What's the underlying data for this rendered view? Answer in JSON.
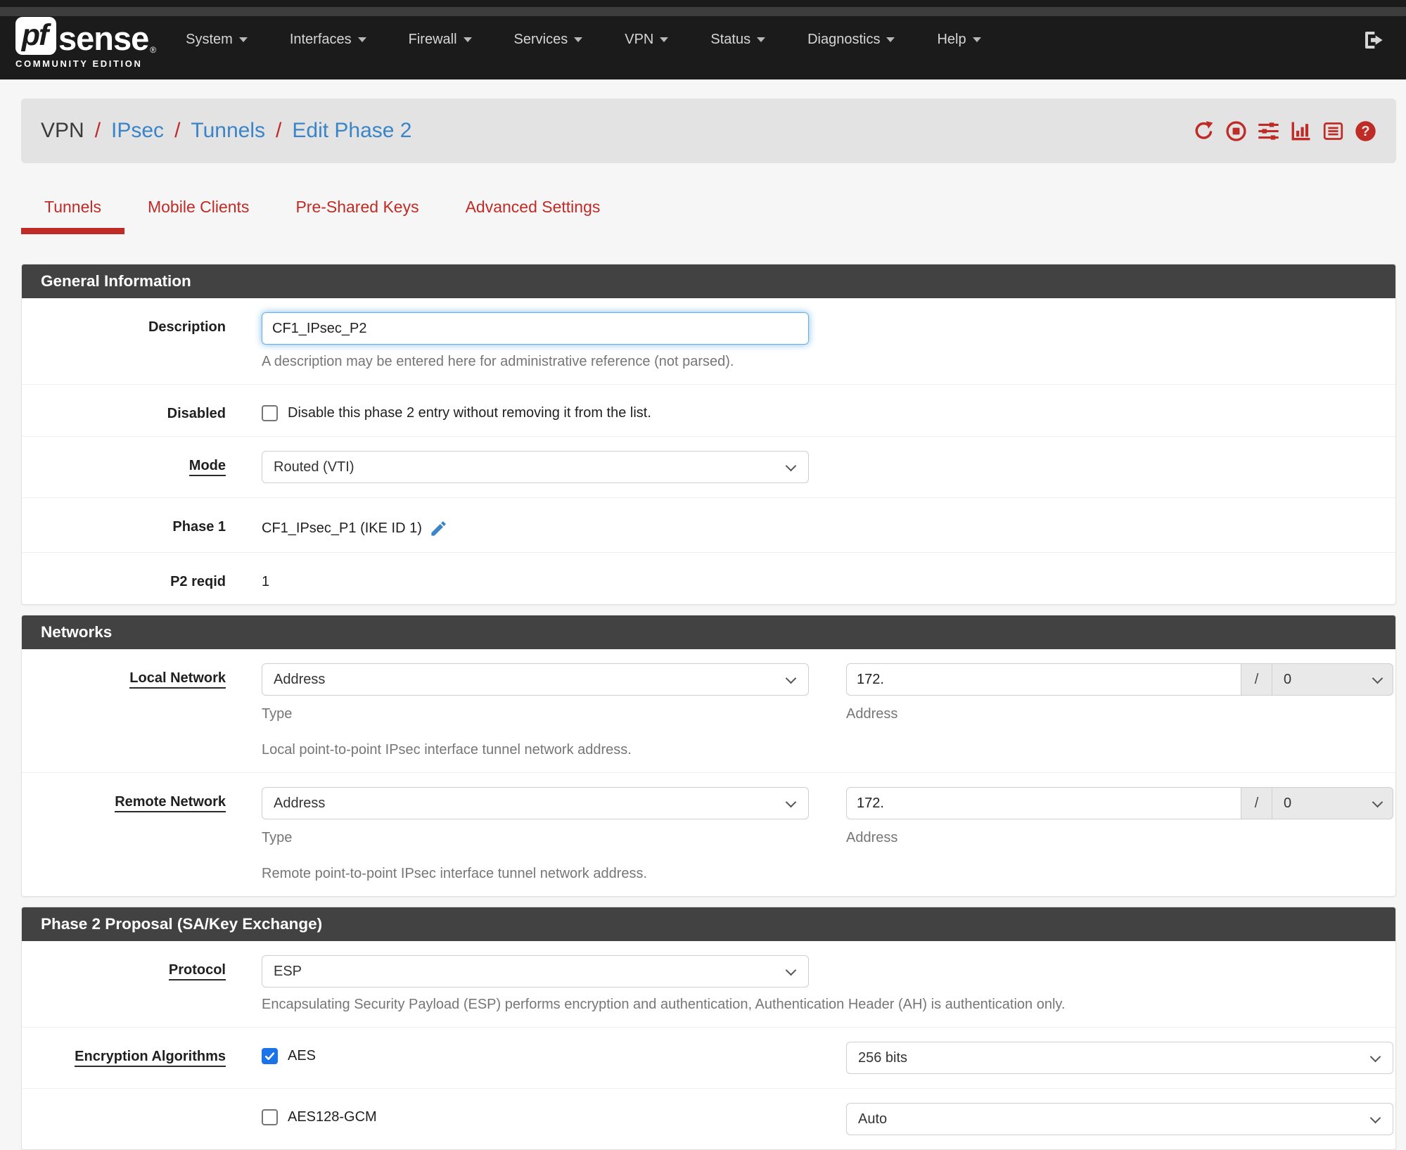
{
  "colors": {
    "navbar_bg": "#1b1b1b",
    "accent_red": "#bf2b26",
    "link_blue": "#3a85c7",
    "panel_header_bg": "#424242",
    "checkbox_blue": "#1a73e8",
    "focus_glow": "#66afe9"
  },
  "navbar": {
    "logo_pf": "pf",
    "logo_sense": "sense",
    "logo_reg": "®",
    "logo_tagline": "COMMUNITY EDITION",
    "items": [
      "System",
      "Interfaces",
      "Firewall",
      "Services",
      "VPN",
      "Status",
      "Diagnostics",
      "Help"
    ],
    "logout_icon": "sign-out-icon"
  },
  "breadcrumb": {
    "root": "VPN",
    "sep": "/",
    "links": [
      "IPsec",
      "Tunnels",
      "Edit Phase 2"
    ],
    "action_icons": [
      "refresh-icon",
      "stop-icon",
      "sliders-icon",
      "bar-chart-icon",
      "log-icon",
      "help-icon"
    ]
  },
  "tabs": [
    "Tunnels",
    "Mobile Clients",
    "Pre-Shared Keys",
    "Advanced Settings"
  ],
  "general": {
    "title": "General Information",
    "description": {
      "label": "Description",
      "value": "CF1_IPsec_P2",
      "help": "A description may be entered here for administrative reference (not parsed)."
    },
    "disabled": {
      "label": "Disabled",
      "text": "Disable this phase 2 entry without removing it from the list.",
      "checked": false
    },
    "mode": {
      "label": "Mode",
      "value": "Routed (VTI)"
    },
    "phase1": {
      "label": "Phase 1",
      "value": "CF1_IPsec_P1 (IKE ID 1)",
      "edit_icon": "pencil-icon"
    },
    "p2reqid": {
      "label": "P2 reqid",
      "value": "1"
    }
  },
  "networks": {
    "title": "Networks",
    "local": {
      "label": "Local Network",
      "type_value": "Address",
      "type_help": "Type",
      "address_value": "172.",
      "slash": "/",
      "prefix": "0",
      "address_help": "Address",
      "help": "Local point-to-point IPsec interface tunnel network address."
    },
    "remote": {
      "label": "Remote Network",
      "type_value": "Address",
      "type_help": "Type",
      "address_value": "172.",
      "slash": "/",
      "prefix": "0",
      "address_help": "Address",
      "help": "Remote point-to-point IPsec interface tunnel network address."
    }
  },
  "proposal": {
    "title": "Phase 2 Proposal (SA/Key Exchange)",
    "protocol": {
      "label": "Protocol",
      "value": "ESP",
      "help": "Encapsulating Security Payload (ESP) performs encryption and authentication, Authentication Header (AH) is authentication only."
    },
    "encryption": {
      "label": "Encryption Algorithms",
      "algorithms": [
        {
          "name": "AES",
          "checked": true,
          "keylen": "256 bits"
        },
        {
          "name": "AES128-GCM",
          "checked": false,
          "keylen": "Auto"
        }
      ]
    }
  }
}
